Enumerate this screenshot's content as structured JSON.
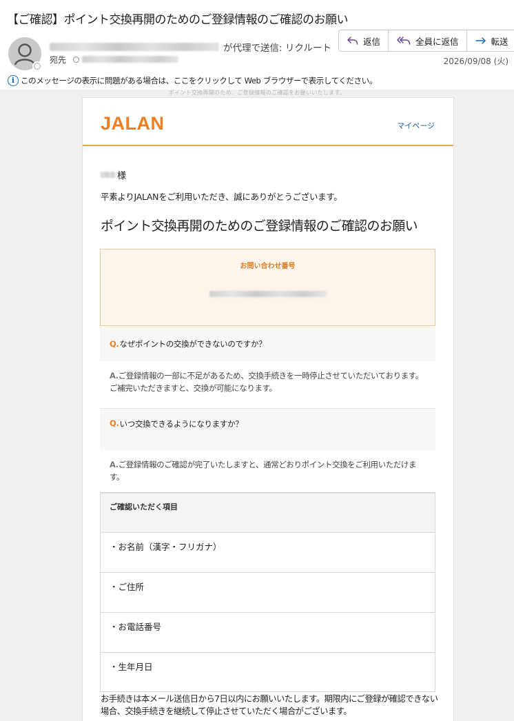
{
  "email": {
    "subject": "【ご確認】ポイント交換再開のためのご登録情報のご確認のお願い",
    "sender_suffix": "が代理で送信: リクルート",
    "to_label": "宛先",
    "date": "2026/09/08 (火)",
    "actions": [
      {
        "label": "返信",
        "icon": "reply-icon"
      },
      {
        "label": "全員に返信",
        "icon": "reply-all-icon"
      },
      {
        "label": "転送",
        "icon": "forward-icon"
      }
    ],
    "info_notice": "このメッセージの表示に問題がある場合は、ここをクリックして Web ブラウザーで表示してください。",
    "preheader": "ポイント交換再開のため、ご登録情報のご確認をお願いいたします。"
  },
  "body": {
    "logo": "JALAN",
    "mypage_link": "マイページ",
    "honorific": "様",
    "thanks": "平素よりJALANをご利用いただき、誠にありがとうございます。",
    "title": "ポイント交換再開のためのご登録情報のご確認のお願い",
    "inquiry_label": "お問い合わせ番号",
    "faq": [
      {
        "q_mark": "Q.",
        "question": "なぜポイントの交換ができないのですか？",
        "a_mark": "A.",
        "answer": "ご登録情報の一部に不足があるため、交換手続きを一時停止させていただいております。ご補完いただきますと、交換が可能になります。"
      },
      {
        "q_mark": "Q.",
        "question": "いつ交換できるようになりますか？",
        "a_mark": "A.",
        "answer": "ご登録情報のご確認が完了いたしますと、通常どおりポイント交換をご利用いただけます。"
      }
    ],
    "items_header": "ご確認いただく項目",
    "items": [
      "・お名前（漢字・フリガナ）",
      "・ご住所",
      "・お電話番号",
      "・生年月日"
    ],
    "footer_note": "お手続きは本メール送信日から7日以内にお願いいたします。期限内にご登録が確認できない場合、交換手続きを継続して停止させていただく場合がございます。"
  },
  "colors": {
    "brand_orange": "#ef7d22",
    "header_rule": "#e0a93d",
    "link_blue": "#1f5fa8",
    "inquiry_bg": "#fdf5ec",
    "inquiry_border": "#f1c49b"
  }
}
